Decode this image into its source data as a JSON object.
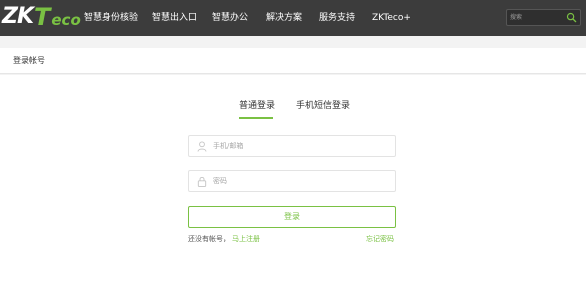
{
  "brand": {
    "logo_main": "ZK",
    "logo_t": "T",
    "logo_eco": "eco",
    "accent_color": "#7ac143"
  },
  "nav": {
    "items": [
      {
        "label": "智慧身份核验"
      },
      {
        "label": "智慧出入口"
      },
      {
        "label": "智慧办公"
      },
      {
        "label": "解决方案"
      },
      {
        "label": "服务支持"
      },
      {
        "label": "ZKTeco+"
      }
    ],
    "search_placeholder": "搜索",
    "search_icon": "search-icon"
  },
  "page": {
    "title": "登录帐号"
  },
  "login": {
    "tabs": [
      {
        "label": "普通登录",
        "active": true
      },
      {
        "label": "手机短信登录",
        "active": false
      }
    ],
    "username_placeholder": "手机/邮箱",
    "username_icon": "user-icon",
    "password_placeholder": "密码",
    "password_icon": "lock-icon",
    "submit_label": "登录",
    "no_account_text": "还没有帐号，",
    "register_link": "马上注册",
    "forgot_link": "忘记密码"
  }
}
